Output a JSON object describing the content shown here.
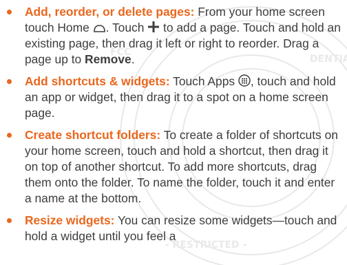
{
  "colors": {
    "accent": "#e9671e",
    "text": "#3d3d3d",
    "watermark": "#e6e6e6"
  },
  "bullets": [
    {
      "title": "Add, reorder, or delete pages:",
      "t1": " From your home screen touch Home ",
      "t2": ". Touch ",
      "t3": " to add a page. Touch and hold an existing page, then drag it left or right to reorder. Drag a page up to ",
      "bold": "Remove",
      "t4": ".",
      "icons": [
        "home-icon",
        "plus-icon"
      ]
    },
    {
      "title": "Add shortcuts & widgets:",
      "t1": " Touch Apps ",
      "t2": ", touch and hold an app or widget, then drag it to a spot on a home screen page.",
      "icons": [
        "apps-icon"
      ]
    },
    {
      "title": "Create shortcut folders:",
      "text": " To create a folder of shortcuts on your home screen, touch and hold a shortcut, then drag it on top of another shortcut. To add more shortcuts, drag them onto the folder. To name the folder, touch it and enter a name at the bottom."
    },
    {
      "title": "Resize widgets:",
      "text": " You can resize some widgets—touch and hold a widget until you feel a"
    }
  ]
}
